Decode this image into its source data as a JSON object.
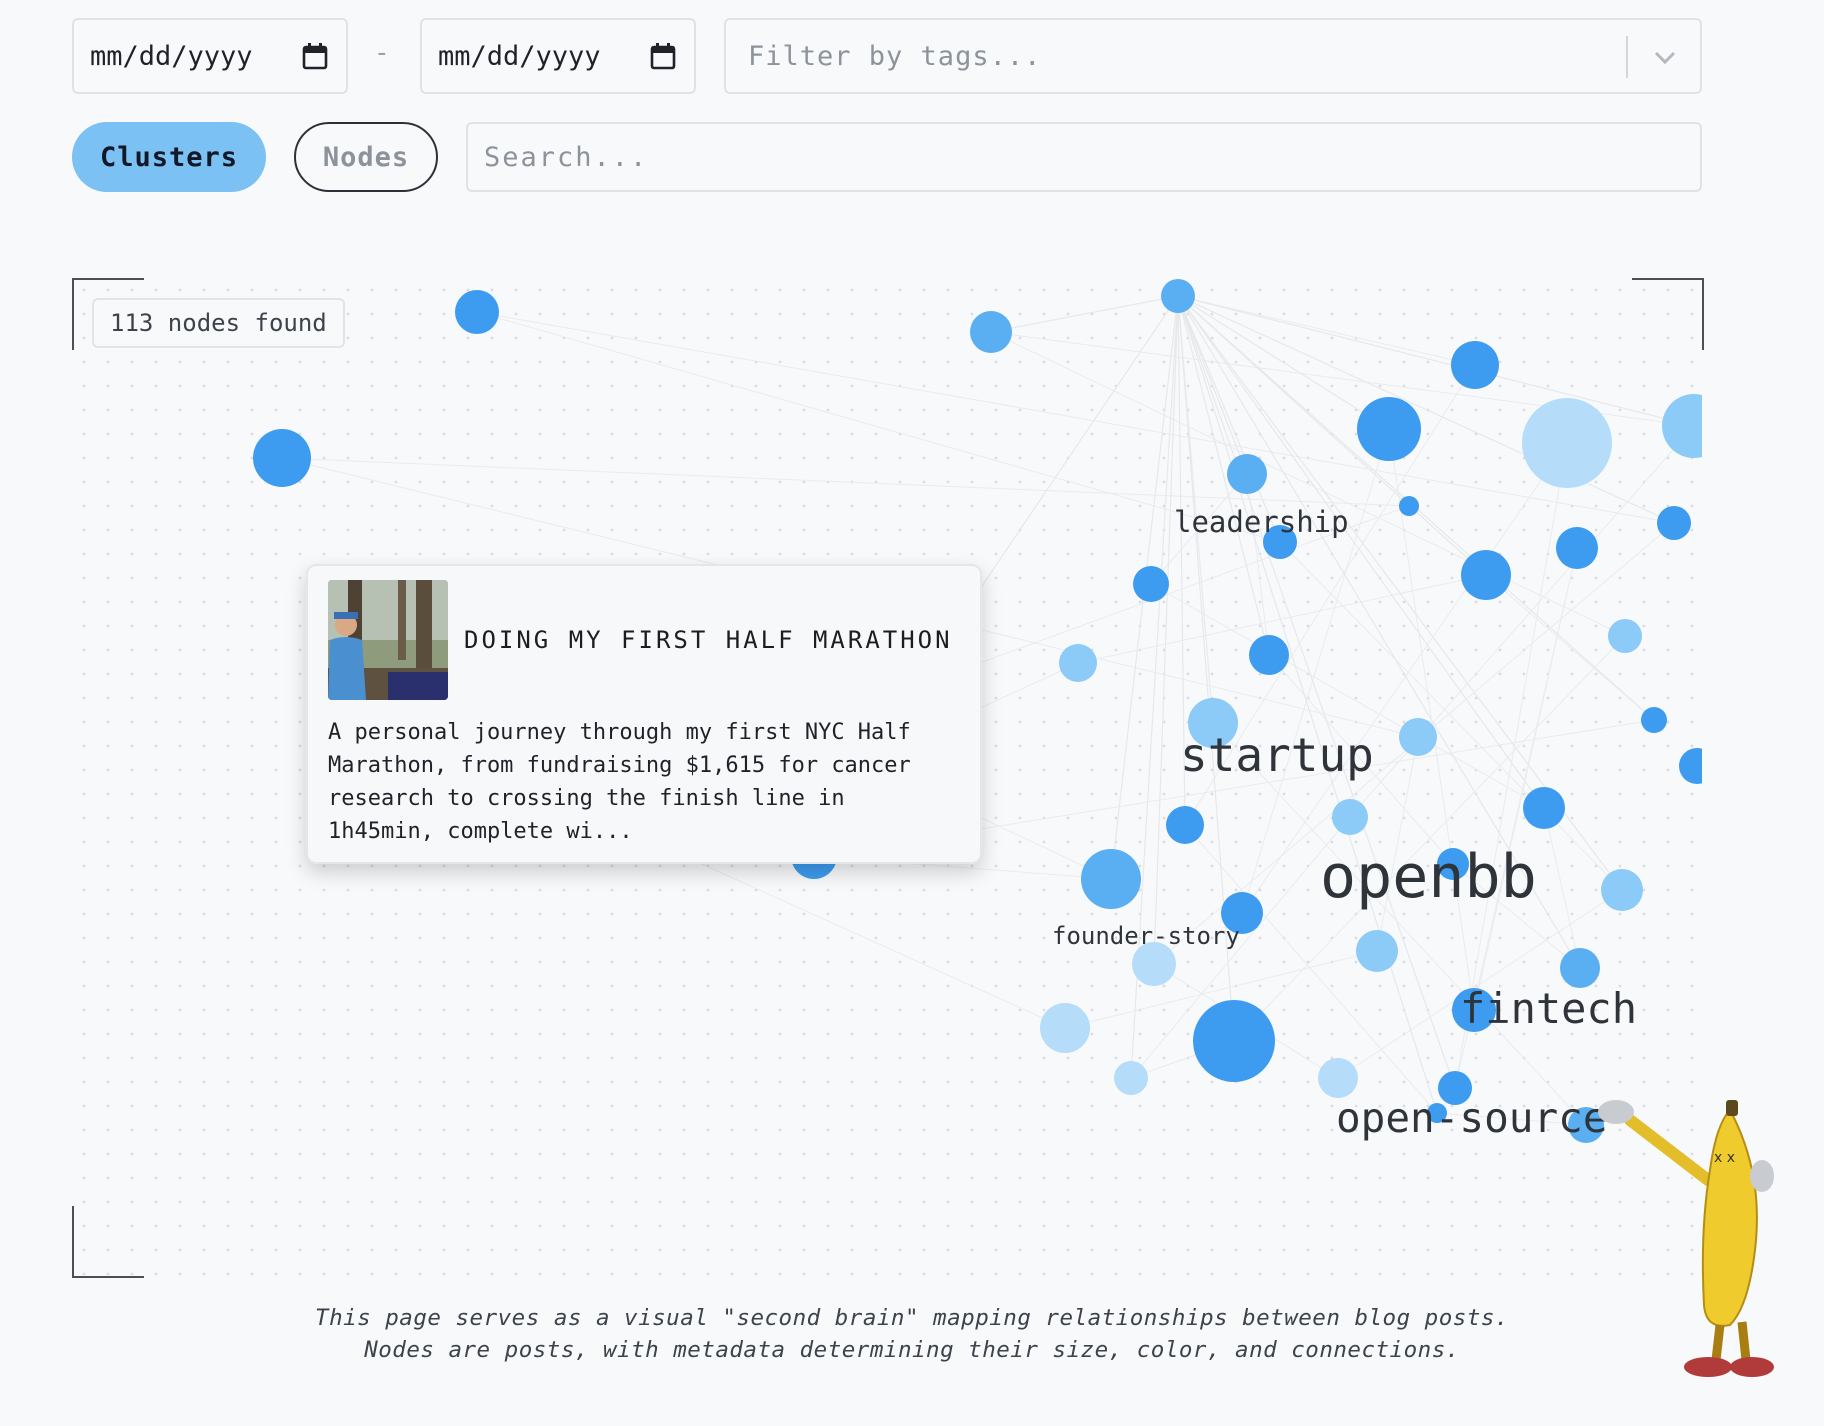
{
  "filters": {
    "start_date_placeholder": "mm/dd/yyyy",
    "end_date_placeholder": "mm/dd/yyyy",
    "date_separator": "-",
    "tags_placeholder": "Filter by tags..."
  },
  "view_toggle": {
    "clusters_label": "Clusters",
    "nodes_label": "Nodes",
    "active": "Clusters"
  },
  "search": {
    "placeholder": "Search..."
  },
  "graph": {
    "node_count_text": "113 nodes found",
    "cluster_labels": [
      "leadership",
      "startup",
      "openbb",
      "founder-story",
      "fintech",
      "open-source"
    ],
    "node_colors": [
      "#3d9bf0",
      "#5aaef2",
      "#8ccaf7",
      "#b5dcf9"
    ]
  },
  "hover_card": {
    "title": "DOING MY FIRST HALF MARATHON",
    "excerpt": "A personal journey through my first NYC Half Marathon, from fundraising $1,615 for cancer research to crossing the finish line in 1h45min, complete wi..."
  },
  "footer": {
    "line1": "This page serves as a visual \"second brain\" mapping relationships between blog posts.",
    "line2": "Nodes are posts, with metadata determining their size, color, and connections."
  },
  "icons": {
    "calendar": "calendar-icon",
    "dropdown": "chevron-down-icon",
    "mascot": "banana-mascot"
  }
}
